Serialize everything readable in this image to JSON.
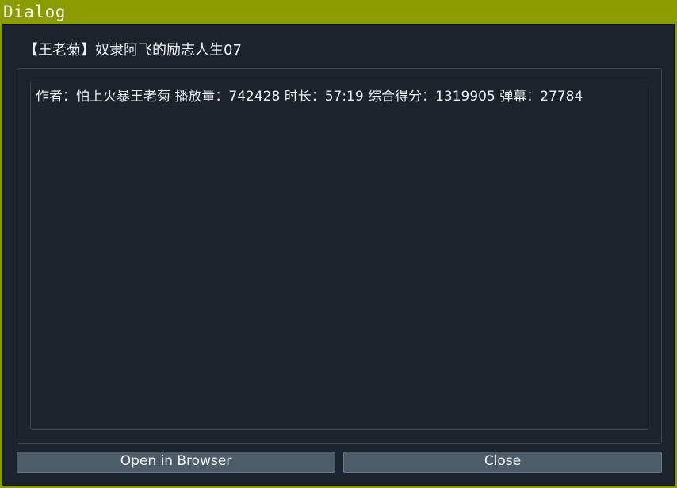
{
  "window": {
    "title": "Dialog"
  },
  "dialog": {
    "video_title": "【王老菊】奴隶阿飞的励志人生07",
    "info_text": "作者：怕上火暴王老菊 播放量：742428 时长：57:19 综合得分：1319905 弹幕：27784",
    "buttons": {
      "open_label": "Open in Browser",
      "close_label": "Close"
    }
  }
}
